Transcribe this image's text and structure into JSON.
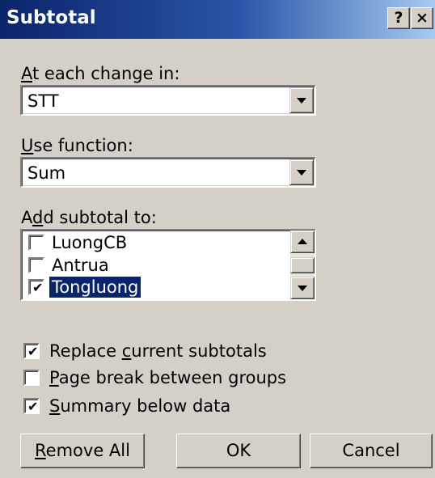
{
  "window": {
    "title": "Subtotal",
    "help_label": "?",
    "close_label": "×"
  },
  "change_in": {
    "label_accel": "A",
    "label_rest": "t each change in:",
    "value": "STT"
  },
  "use_function": {
    "label_accel": "U",
    "label_rest": "se function:",
    "value": "Sum"
  },
  "add_subtotal": {
    "label_pre": "A",
    "label_accel": "d",
    "label_post": "d subtotal to:",
    "items": [
      {
        "label": "LuongCB",
        "checked": false,
        "selected": false
      },
      {
        "label": "Antrua",
        "checked": false,
        "selected": false
      },
      {
        "label": "Tongluong",
        "checked": true,
        "selected": true
      }
    ]
  },
  "options": {
    "replace": {
      "pre": "Replace ",
      "accel": "c",
      "post": "urrent subtotals",
      "checked": true
    },
    "page_break": {
      "pre": "",
      "accel": "P",
      "post": "age break between groups",
      "checked": false
    },
    "summary": {
      "pre": "",
      "accel": "S",
      "post": "ummary below data",
      "checked": true
    }
  },
  "buttons": {
    "remove_all_accel": "R",
    "remove_all_rest": "emove All",
    "ok": "OK",
    "cancel": "Cancel"
  },
  "check_glyph": "✔",
  "colors": {
    "title_gradient_start": "#0a246a",
    "title_gradient_end": "#a6caf0",
    "face": "#d4d0c8",
    "selection": "#0a246a"
  }
}
